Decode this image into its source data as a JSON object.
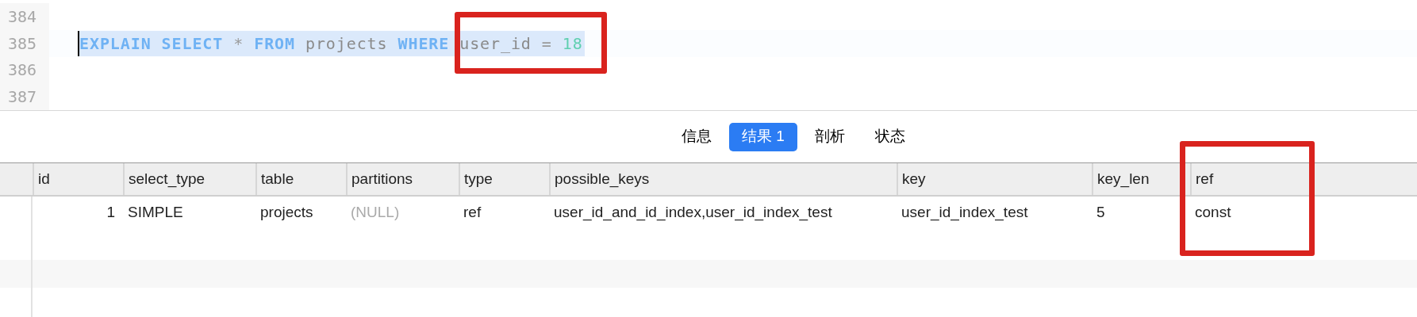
{
  "editor": {
    "lines": [
      {
        "number": "384",
        "selected": false
      },
      {
        "number": "385",
        "selected": true,
        "tokens": [
          {
            "kind": "keyword",
            "text": "EXPLAIN"
          },
          {
            "kind": "keyword",
            "text": "SELECT"
          },
          {
            "kind": "operator",
            "text": "*"
          },
          {
            "kind": "keyword",
            "text": "FROM"
          },
          {
            "kind": "identifier",
            "text": "projects"
          },
          {
            "kind": "keyword",
            "text": "WHERE"
          },
          {
            "kind": "identifier",
            "text": "user_id"
          },
          {
            "kind": "operator",
            "text": "="
          },
          {
            "kind": "number",
            "text": "18"
          }
        ]
      },
      {
        "number": "386",
        "selected": false
      },
      {
        "number": "387",
        "selected": false
      }
    ]
  },
  "tabs": [
    {
      "label": "信息",
      "selected": false
    },
    {
      "label": "结果 1",
      "selected": true
    },
    {
      "label": "剖析",
      "selected": false
    },
    {
      "label": "状态",
      "selected": false
    }
  ],
  "table": {
    "columns": [
      "id",
      "select_type",
      "table",
      "partitions",
      "type",
      "possible_keys",
      "key",
      "key_len",
      "ref"
    ],
    "rows": [
      {
        "cells": [
          {
            "text": "1",
            "kind": "number"
          },
          {
            "text": "SIMPLE",
            "kind": "text"
          },
          {
            "text": "projects",
            "kind": "text"
          },
          {
            "text": "(NULL)",
            "kind": "null"
          },
          {
            "text": "ref",
            "kind": "text"
          },
          {
            "text": "user_id_and_id_index,user_id_index_test",
            "kind": "text"
          },
          {
            "text": "user_id_index_test",
            "kind": "text"
          },
          {
            "text": "5",
            "kind": "text"
          },
          {
            "text": "const",
            "kind": "text"
          }
        ]
      }
    ]
  }
}
